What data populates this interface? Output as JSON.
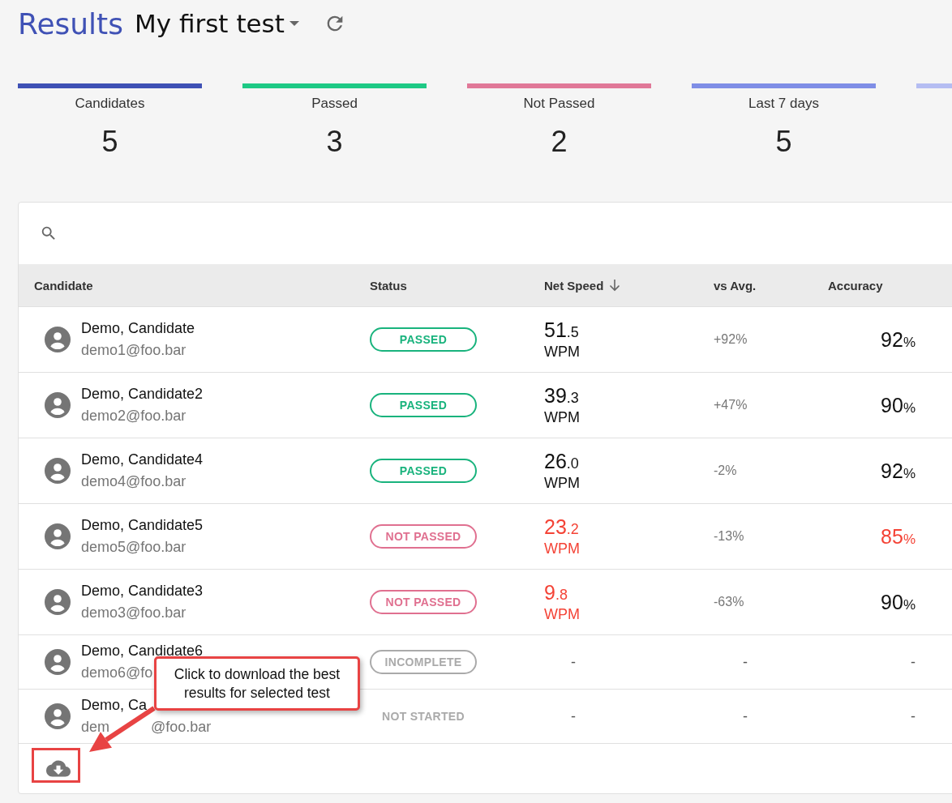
{
  "header": {
    "title": "Results",
    "test_name": "My first test"
  },
  "stats": [
    {
      "label": "Candidates",
      "value": "5",
      "color": "#3f51b5"
    },
    {
      "label": "Passed",
      "value": "3",
      "color": "#1ec985"
    },
    {
      "label": "Not Passed",
      "value": "2",
      "color": "#e07898"
    },
    {
      "label": "Last 7 days",
      "value": "5",
      "color": "#7f8ee6"
    },
    {
      "color": "#b5bdf2"
    }
  ],
  "table": {
    "columns": [
      {
        "label": "Candidate"
      },
      {
        "label": "Status"
      },
      {
        "label": "Net Speed",
        "sorted": true
      },
      {
        "label": "vs Avg."
      },
      {
        "label": "Accuracy"
      }
    ],
    "rows": [
      {
        "name": "Demo, Candidate",
        "email": "demo1@foo.bar",
        "status": {
          "label": "PASSED",
          "kind": "passed"
        },
        "speed": {
          "whole": "51",
          "fraction": ".5",
          "unit": "WPM",
          "low": false
        },
        "vs_avg": "+92%",
        "accuracy": {
          "value": "92",
          "unit": "%",
          "low": false
        }
      },
      {
        "name": "Demo, Candidate2",
        "email": "demo2@foo.bar",
        "status": {
          "label": "PASSED",
          "kind": "passed"
        },
        "speed": {
          "whole": "39",
          "fraction": ".3",
          "unit": "WPM",
          "low": false
        },
        "vs_avg": "+47%",
        "accuracy": {
          "value": "90",
          "unit": "%",
          "low": false
        }
      },
      {
        "name": "Demo, Candidate4",
        "email": "demo4@foo.bar",
        "status": {
          "label": "PASSED",
          "kind": "passed"
        },
        "speed": {
          "whole": "26",
          "fraction": ".0",
          "unit": "WPM",
          "low": false
        },
        "vs_avg": "-2%",
        "accuracy": {
          "value": "92",
          "unit": "%",
          "low": false
        }
      },
      {
        "name": "Demo, Candidate5",
        "email": "demo5@foo.bar",
        "status": {
          "label": "NOT PASSED",
          "kind": "not_passed"
        },
        "speed": {
          "whole": "23",
          "fraction": ".2",
          "unit": "WPM",
          "low": true
        },
        "vs_avg": "-13%",
        "accuracy": {
          "value": "85",
          "unit": "%",
          "low": true
        }
      },
      {
        "name": "Demo, Candidate3",
        "email": "demo3@foo.bar",
        "status": {
          "label": "NOT PASSED",
          "kind": "not_passed"
        },
        "speed": {
          "whole": "9",
          "fraction": ".8",
          "unit": "WPM",
          "low": true
        },
        "vs_avg": "-63%",
        "accuracy": {
          "value": "90",
          "unit": "%",
          "low": false
        }
      },
      {
        "name": "Demo, Candidate6",
        "email": "demo6@fo",
        "status": {
          "label": "INCOMPLETE",
          "kind": "incomplete"
        },
        "speed_text": "-",
        "vs_avg": "-",
        "accuracy_text": "-"
      },
      {
        "name": "Demo, Ca",
        "email_parts": [
          "dem",
          "@foo.bar"
        ],
        "status": {
          "label": "NOT STARTED",
          "kind": "not_started"
        },
        "speed_text": "-",
        "vs_avg": "-",
        "accuracy_text": "-"
      }
    ]
  },
  "callout": {
    "text": "Click to download the best results for selected test"
  }
}
